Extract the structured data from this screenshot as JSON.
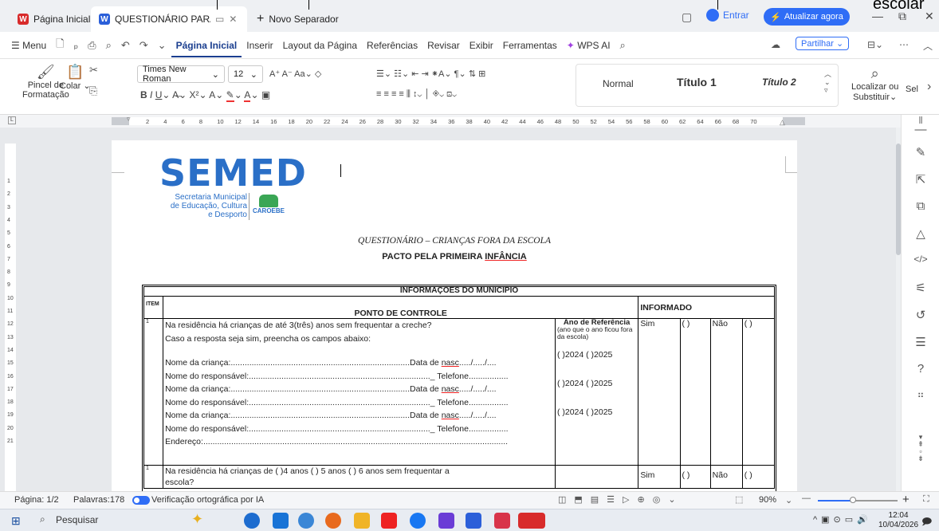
{
  "tabs": [
    {
      "label": "Página Inicial"
    },
    {
      "label": "QUESTIONÁRIO PARA SAÚDE"
    },
    {
      "label": "Novo Separador"
    }
  ],
  "window": {
    "signin": "Entrar",
    "update": "Atualizar agora",
    "overflow_text": "escolar"
  },
  "menu": {
    "menu_label": "Menu",
    "items": [
      "Página Inicial",
      "Inserir",
      "Layout da Página",
      "Referências",
      "Revisar",
      "Exibir",
      "Ferramentas"
    ],
    "wps_ai": "WPS AI",
    "share": "Partilhar"
  },
  "ribbon": {
    "painter": "Pincel de Formatação",
    "painter_line1": "Pincel de",
    "painter_line2": "Formatação",
    "paste": "Colar",
    "font": "Times New Roman",
    "size": "12",
    "styles": [
      "Normal",
      "Título 1",
      "Título 2"
    ],
    "find_line1": "Localizar ou",
    "find_line2": "Substituir",
    "select": "Sel"
  },
  "ruler_ticks": [
    "2",
    "4",
    "6",
    "8",
    "10",
    "12",
    "14",
    "16",
    "18",
    "20",
    "22",
    "24",
    "26",
    "28",
    "30",
    "32",
    "34",
    "36",
    "38",
    "40",
    "42",
    "44",
    "46",
    "48",
    "50",
    "52",
    "54",
    "56",
    "58",
    "60",
    "62",
    "64",
    "66",
    "68",
    "70"
  ],
  "vruler_ticks": [
    "1",
    "2",
    "3",
    "4",
    "5",
    "6",
    "7",
    "8",
    "9",
    "10",
    "11",
    "12",
    "13",
    "14",
    "15",
    "16",
    "17",
    "18",
    "19",
    "20",
    "21"
  ],
  "doc": {
    "logo_text": "SEMED",
    "logo_sub1": "Secretaria Municipal",
    "logo_sub2": "de Educação, Cultura",
    "logo_sub3": "e Desporto",
    "logo_city": "CAROEBE",
    "title_italic": "QUESTIONÁRIO – CRIANÇAS FORA DA ESCOLA",
    "title_bold_a": "PACTO PELA PRIMEIRA ",
    "title_bold_b": "INFÂNCIA",
    "table": {
      "header": "INFORMAÇÕES DO MUNICÍPIO",
      "col_item": "ITEM",
      "col_control": "PONTO DE CONTROLE",
      "col_informed": "INFORMADO",
      "row1": {
        "item": "1",
        "question": "Na residência há crianças de até 3(três) anos sem frequentar a creche?",
        "instruction": "Caso a resposta seja sim, preencha os campos abaixo:",
        "ref_title": "Ano de Referência",
        "ref_note": "(ano que o ano ficou fora da escola)",
        "sim": "Sim",
        "sim_box": "(   )",
        "nao": "Não",
        "nao_box": "(  )",
        "lines": [
          "Nome da criança:.............................................................................Data de ",
          "Nome do responsável:.............................................................................._ Telefone.................",
          "Nome da criança:.............................................................................Data de ",
          "Nome do responsável:.............................................................................._ Telefone.................",
          "Nome da criança:.............................................................................Data de ",
          "Nome do responsável:.............................................................................._ Telefone.................",
          "Endereço:..................................................................................................................................."
        ],
        "nasc": "nasc",
        "date_tail": "...../...../....",
        "years": "(  )2024  (  )2025"
      },
      "row2": {
        "item": "1",
        "question": "Na residência há crianças de (       )4 anos      (      ) 5 anos      (      ) 6 anos sem frequentar a",
        "question2": "escola?",
        "sim": "Sim",
        "sim_box": "(   )",
        "nao": "Não",
        "nao_box": "(  )"
      }
    }
  },
  "status": {
    "page": "Página: 1/2",
    "words": "Palavras:178",
    "spell": "Verificação ortográfica por IA",
    "zoom": "90%"
  },
  "taskbar": {
    "search": "Pesquisar",
    "time": "12:04",
    "date": "10/04/2026"
  },
  "colors": {
    "accent": "#1a3e8f",
    "update_btn": "#2f6df6",
    "logo_blue": "#2a6fc7",
    "wps_red": "#d82b2b"
  }
}
